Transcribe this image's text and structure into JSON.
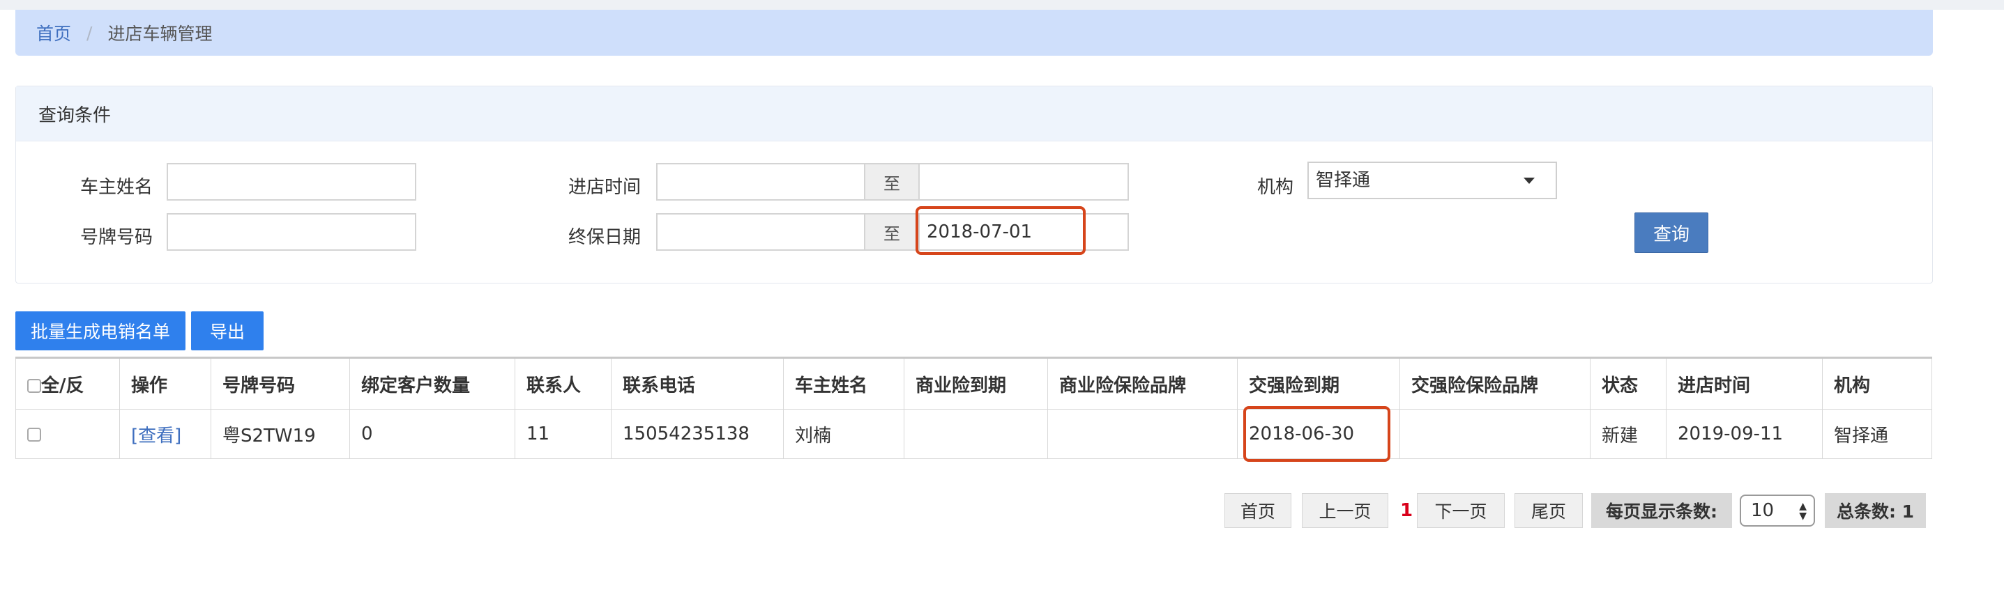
{
  "breadcrumb": {
    "home": "首页",
    "separator": "/",
    "current": "进店车辆管理"
  },
  "query": {
    "title": "查询条件",
    "owner_name_label": "车主姓名",
    "owner_name_value": "",
    "plate_label": "号牌号码",
    "plate_value": "",
    "visit_time_label": "进店时间",
    "visit_time_from": "",
    "visit_time_to": "",
    "to_text": "至",
    "expire_label": "终保日期",
    "expire_from": "",
    "expire_to": "2018-07-01",
    "org_label": "机构",
    "org_value": "智择通",
    "search_button": "查询"
  },
  "actions": {
    "batch_label": "批量生成电销名单",
    "export_label": "导出"
  },
  "table": {
    "headers": [
      "全/反",
      "操作",
      "号牌号码",
      "绑定客户数量",
      "联系人",
      "联系电话",
      "车主姓名",
      "商业险到期",
      "商业险保险品牌",
      "交强险到期",
      "交强险保险品牌",
      "状态",
      "进店时间",
      "机构"
    ],
    "rows": [
      {
        "op": "[查看]",
        "plate": "粤S2TW19",
        "bound_count": "0",
        "contact": "11",
        "phone": "15054235138",
        "owner": "刘楠",
        "commercial_expire": "",
        "commercial_brand": "",
        "compulsory_expire": "2018-06-30",
        "compulsory_brand": "",
        "status": "新建",
        "visit_time": "2019-09-11",
        "org": "智择通"
      }
    ]
  },
  "pager": {
    "first": "首页",
    "prev": "上一页",
    "current": "1",
    "next": "下一页",
    "last": "尾页",
    "page_size_label": "每页显示条数:",
    "page_size": "10",
    "total": "总条数: 1"
  },
  "colors": {
    "highlight": "#d6451b",
    "primary": "#4a7cbf",
    "action": "#2f80ed",
    "breadcrumb_bg": "#cfdffb"
  }
}
